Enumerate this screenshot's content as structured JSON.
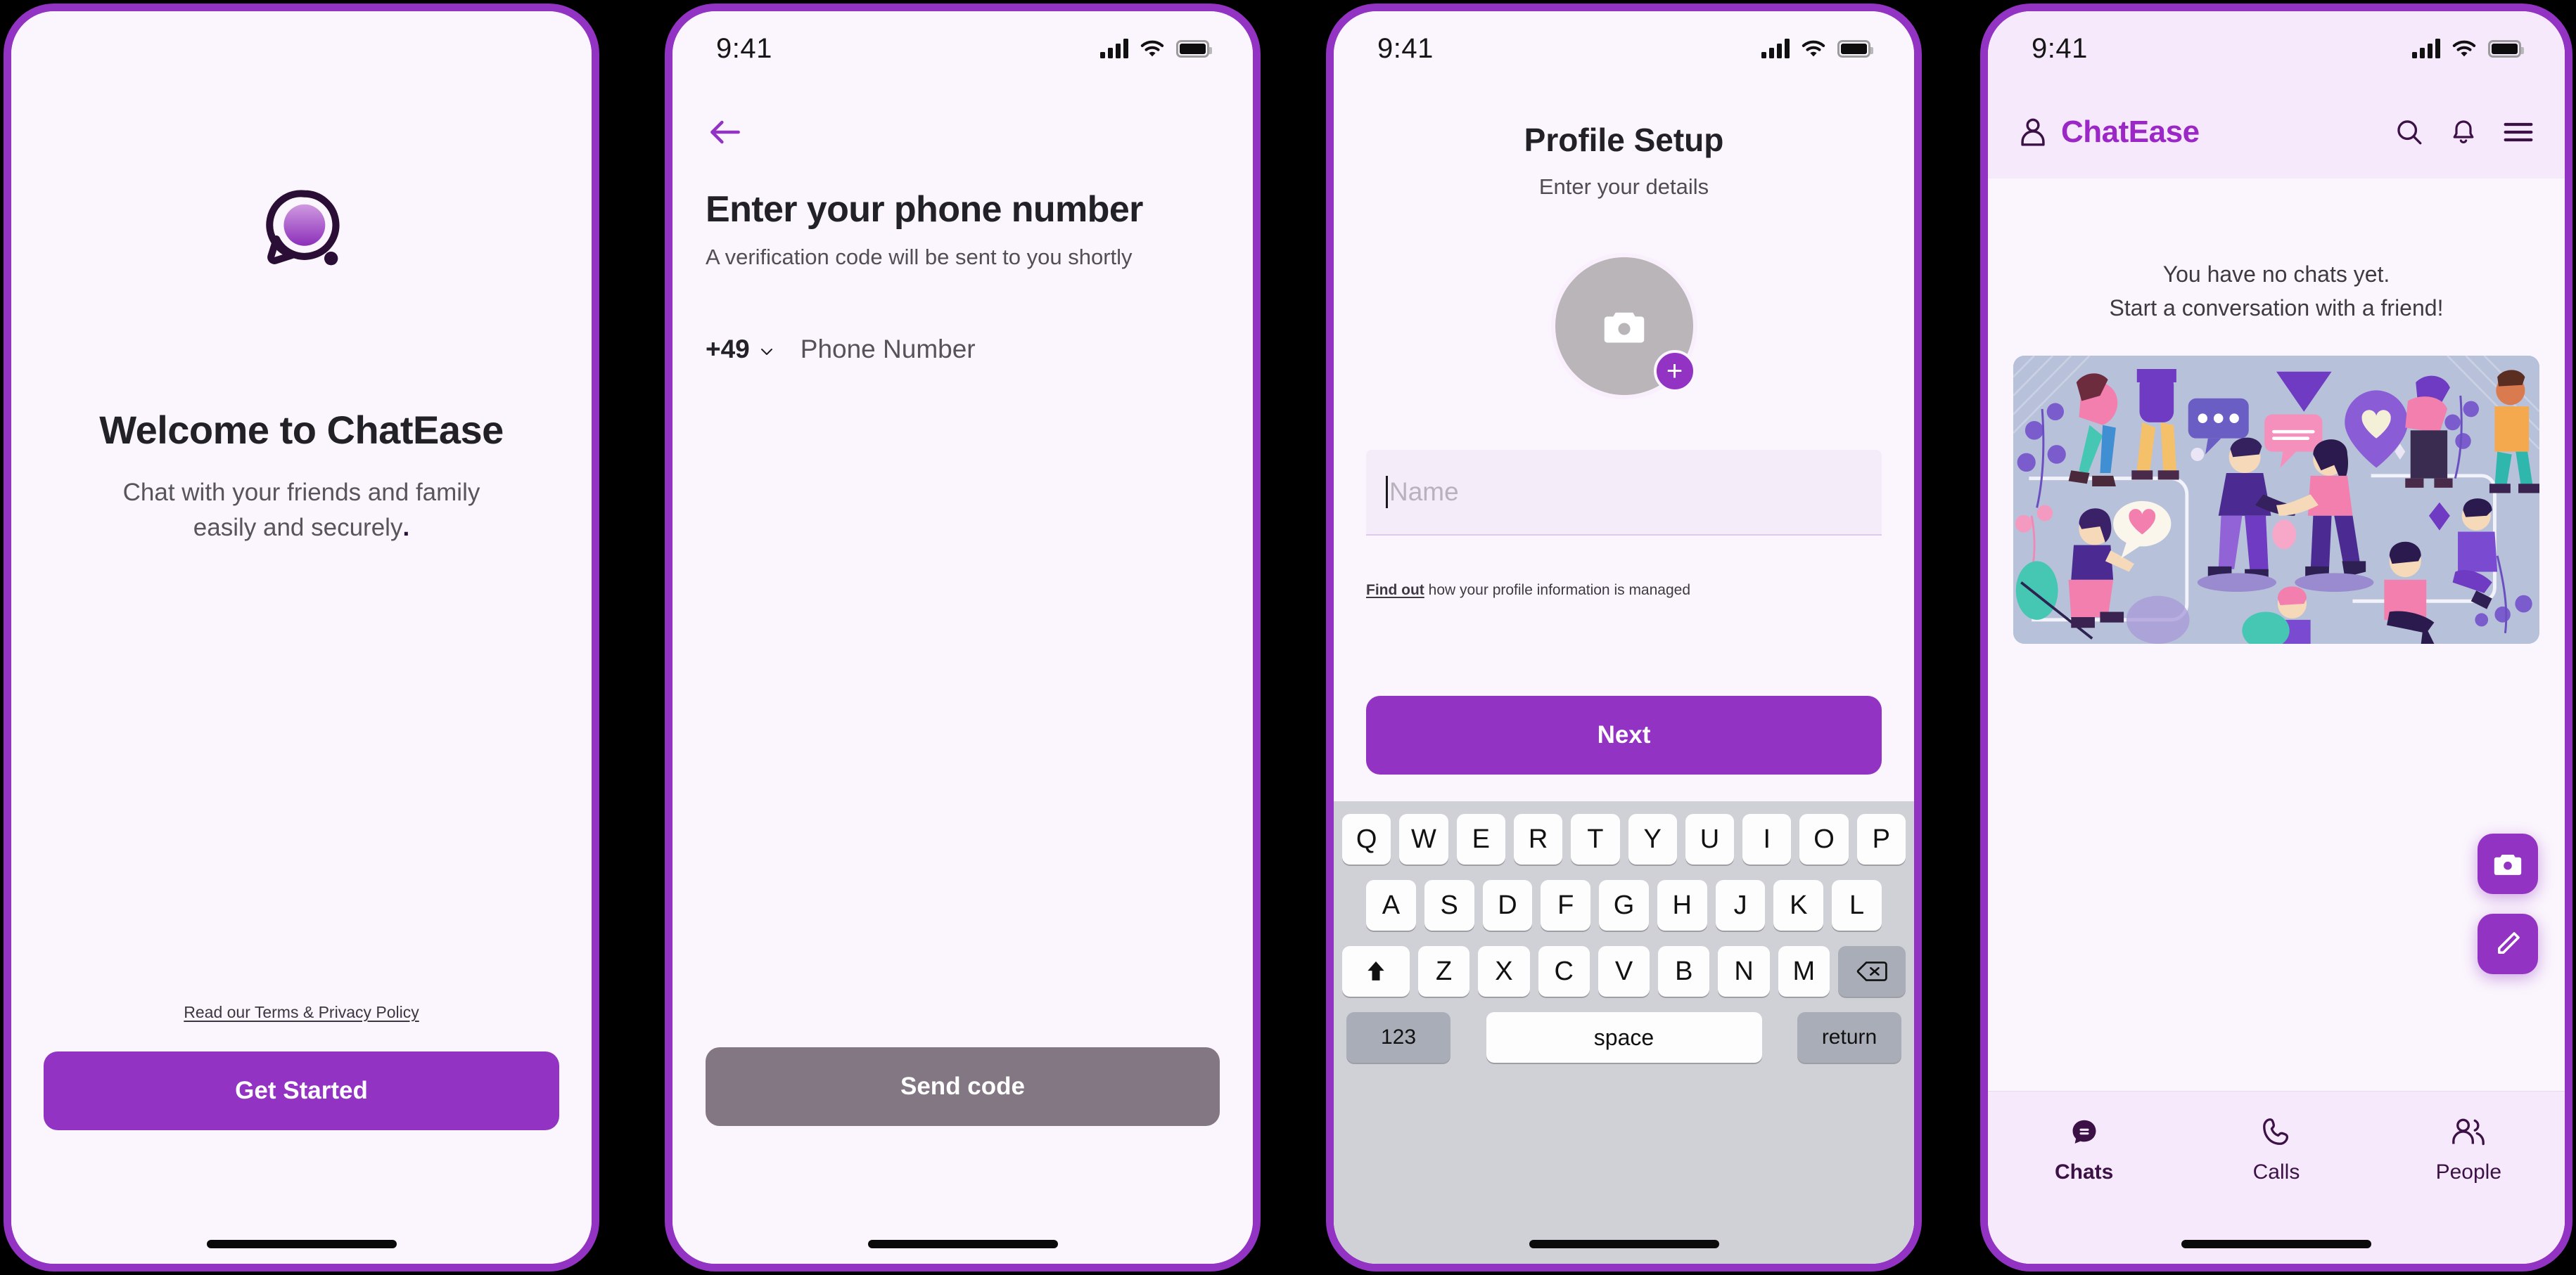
{
  "brand": {
    "name": "ChatEase",
    "accent": "#9333c4",
    "accent_dark": "#3b1146",
    "screen_bg": "#fbf6fd",
    "header_bg": "#f6e9fb",
    "disabled": "#837783"
  },
  "status_bar": {
    "time": "9:41",
    "signal_icon": "cellular-bars-icon",
    "wifi_icon": "wifi-icon",
    "battery_icon": "battery-full-icon"
  },
  "screen1_welcome": {
    "logo_icon": "chat-bubble-logo-icon",
    "title": "Welcome to ChatEase",
    "subtitle_line1": "Chat with your friends and family",
    "subtitle_line2": "easily and securely",
    "subtitle_dot": ".",
    "terms_link": "Read our Terms & Privacy Policy",
    "cta_label": "Get Started"
  },
  "screen2_phone": {
    "back_icon": "arrow-left-icon",
    "title": "Enter your phone number",
    "subtitle": "A verification code will be sent to you shortly",
    "country_code": "+49",
    "country_chevron_icon": "chevron-down-icon",
    "phone_placeholder": "Phone Number",
    "cta_label": "Send code",
    "cta_disabled": true
  },
  "screen3_profile": {
    "title": "Profile Setup",
    "subtitle": "Enter your details",
    "avatar_icon": "camera-icon",
    "avatar_add_icon": "plus-icon",
    "name_value": "",
    "name_placeholder": "Name",
    "note_link": "Find out",
    "note_rest": " how your profile information is managed",
    "cta_label": "Next",
    "keyboard": {
      "row1": [
        "Q",
        "W",
        "E",
        "R",
        "T",
        "Y",
        "U",
        "I",
        "O",
        "P"
      ],
      "row2": [
        "A",
        "S",
        "D",
        "F",
        "G",
        "H",
        "J",
        "K",
        "L"
      ],
      "row3": [
        "Z",
        "X",
        "C",
        "V",
        "B",
        "N",
        "M"
      ],
      "shift_icon": "shift-arrow-up-icon",
      "backspace_icon": "backspace-delete-icon",
      "num_label": "123",
      "space_label": "space",
      "return_label": "return"
    }
  },
  "screen4_chats": {
    "profile_icon": "person-icon",
    "app_title": "ChatEase",
    "search_icon": "search-icon",
    "bell_icon": "bell-notification-icon",
    "menu_icon": "hamburger-menu-icon",
    "empty_line1": "You have no chats yet.",
    "empty_line2": "Start a conversation with a friend!",
    "illustration_alt": "people-chatting-illustration",
    "fab_camera_icon": "camera-icon",
    "fab_compose_icon": "pencil-edit-icon",
    "tabs": [
      {
        "label": "Chats",
        "icon": "chat-bubble-icon",
        "active": true
      },
      {
        "label": "Calls",
        "icon": "phone-handset-icon",
        "active": false
      },
      {
        "label": "People",
        "icon": "people-group-icon",
        "active": false
      }
    ]
  }
}
